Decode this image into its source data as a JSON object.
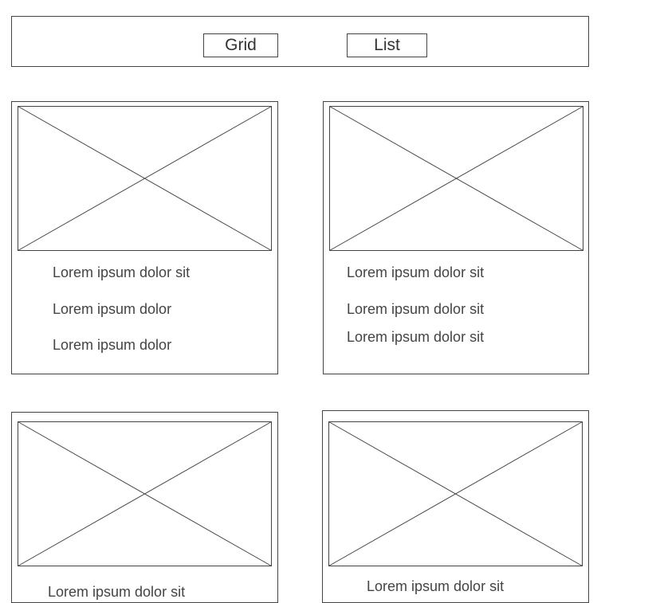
{
  "toolbar": {
    "grid_label": "Grid",
    "list_label": "List"
  },
  "cards": [
    {
      "lines": [
        "Lorem ipsum dolor sit",
        "Lorem ipsum dolor",
        "Lorem ipsum dolor"
      ]
    },
    {
      "lines": [
        "Lorem ipsum dolor sit",
        "Lorem ipsum dolor sit",
        "Lorem ipsum dolor sit"
      ]
    },
    {
      "lines": [
        "Lorem ipsum dolor sit"
      ]
    },
    {
      "lines": [
        "Lorem ipsum dolor sit"
      ]
    }
  ],
  "icons": {
    "image_placeholder": "image-placeholder-icon"
  },
  "colors": {
    "stroke": "#444444",
    "text": "#444444",
    "background": "#ffffff"
  }
}
